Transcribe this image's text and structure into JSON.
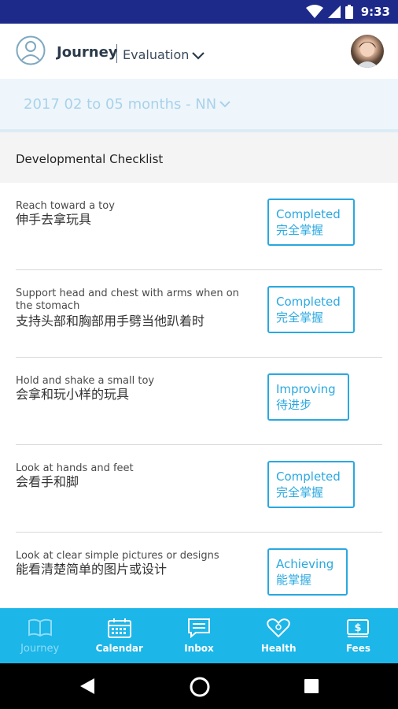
{
  "status_bar": {
    "time": "9:33",
    "bg_color": "#1e2a8a"
  },
  "header": {
    "title": "Journey",
    "subtitle": "Evaluation",
    "profile_icon": "person-outline-icon",
    "dropdown_icon": "chevron-down-icon"
  },
  "filter": {
    "value": "2017 02 to 05 months - NN",
    "dropdown_icon": "chevron-down-icon"
  },
  "section": {
    "title": "Developmental Checklist"
  },
  "checklist": [
    {
      "en": "Reach toward a toy",
      "zh": "伸手去拿玩具",
      "status_en": "Completed",
      "status_zh": "完全掌握"
    },
    {
      "en": "Support head and chest with arms when on the stomach",
      "zh": "支持头部和胸部用手劈当他趴着时",
      "status_en": "Completed",
      "status_zh": "完全掌握"
    },
    {
      "en": "Hold and shake a small toy",
      "zh": "会拿和玩小样的玩具",
      "status_en": "Improving",
      "status_zh": "待进步"
    },
    {
      "en": "Look at hands and feet",
      "zh": "会看手和脚",
      "status_en": "Completed",
      "status_zh": "完全掌握"
    },
    {
      "en": "Look at clear simple pictures or designs",
      "zh": "能看清楚简单的图片或设计",
      "status_en": "Achieving",
      "status_zh": "能掌握"
    }
  ],
  "bottom_nav": [
    {
      "label": "Journey",
      "icon": "book-icon",
      "active": true
    },
    {
      "label": "Calendar",
      "icon": "calendar-icon",
      "active": false
    },
    {
      "label": "Inbox",
      "icon": "message-icon",
      "active": false
    },
    {
      "label": "Health",
      "icon": "heart-icon",
      "active": false
    },
    {
      "label": "Fees",
      "icon": "dollar-icon",
      "active": false
    }
  ],
  "colors": {
    "accent": "#29a8e0",
    "nav_bg": "#1cb6e8",
    "filter_text": "#a9d2ea"
  }
}
